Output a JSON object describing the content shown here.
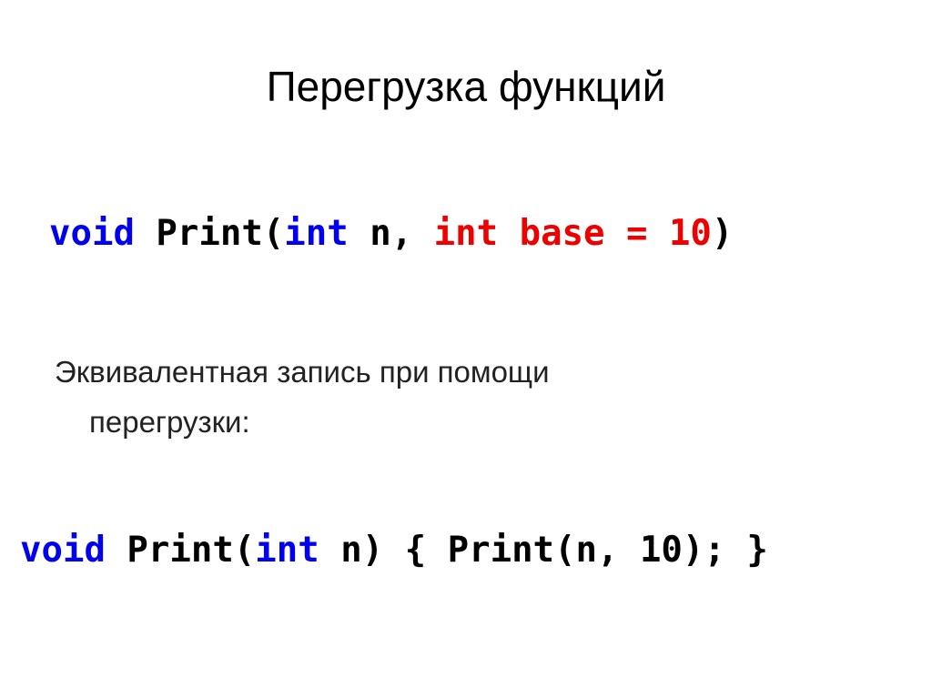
{
  "slide": {
    "title": "Перегрузка функций",
    "code_line_1": {
      "parts": [
        "void",
        " Print(",
        "int",
        " n, ",
        "int base = 10",
        ")"
      ]
    },
    "description_line_1": "Эквивалентная запись при помощи",
    "description_line_2": "перегрузки:",
    "code_line_2": {
      "parts": [
        "void",
        " Print(",
        "int",
        " n) { Print(n, 10); }"
      ]
    },
    "colors": {
      "keyword": "#0000ee",
      "default_param": "#ee0000",
      "text": "#000000"
    }
  }
}
